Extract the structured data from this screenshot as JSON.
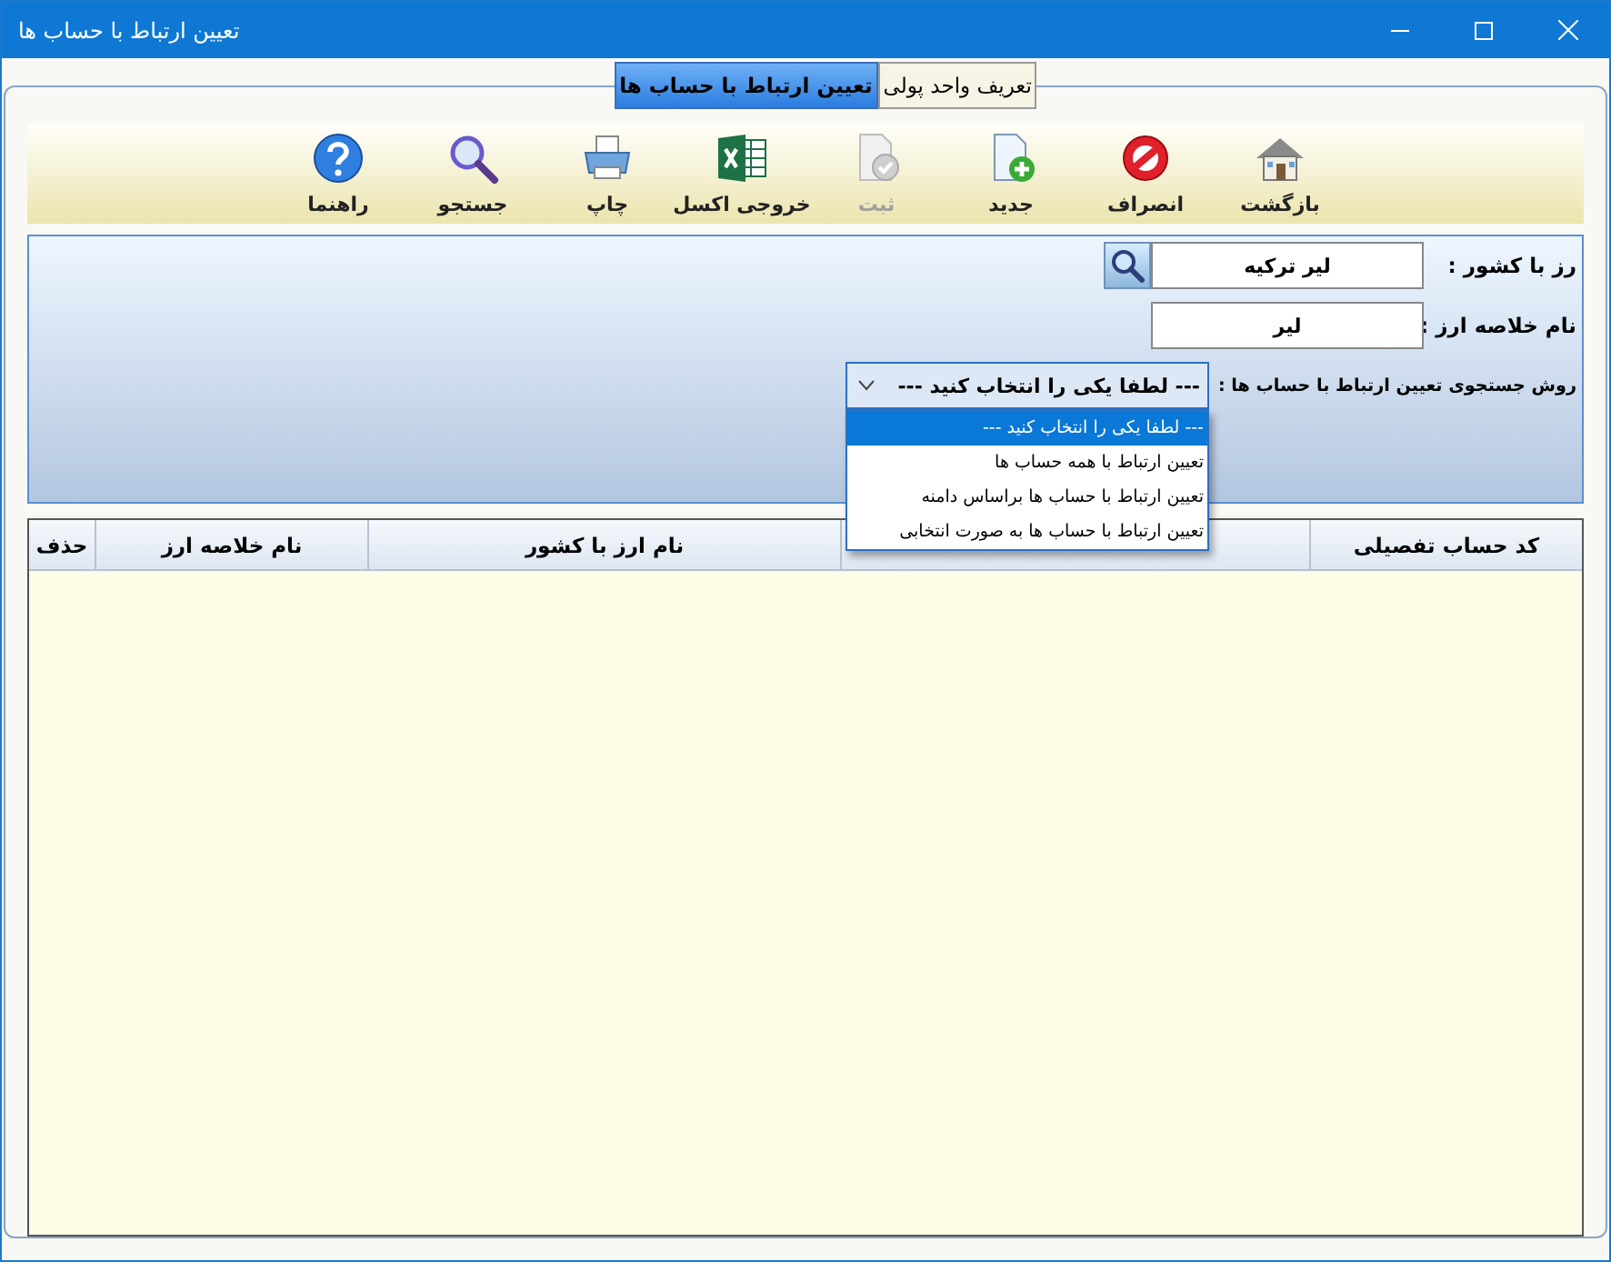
{
  "window": {
    "title": "تعیین ارتباط با حساب ها"
  },
  "tabs": [
    {
      "label": "تعریف واحد پولی",
      "selected": false
    },
    {
      "label": "تعیین ارتباط با حساب ها",
      "selected": true
    }
  ],
  "toolbar": [
    {
      "kind": "home",
      "label": "بازگشت",
      "disabled": false
    },
    {
      "kind": "cancel",
      "label": "انصراف",
      "disabled": false
    },
    {
      "kind": "new",
      "label": "جدید",
      "disabled": false
    },
    {
      "kind": "save",
      "label": "ثبت",
      "disabled": true
    },
    {
      "kind": "excel",
      "label": "خروجی اکسل",
      "disabled": false
    },
    {
      "kind": "print",
      "label": "چاپ",
      "disabled": false
    },
    {
      "kind": "search",
      "label": "جستجو",
      "disabled": false
    },
    {
      "kind": "help",
      "label": "راهنما",
      "disabled": false
    }
  ],
  "form": {
    "currency": {
      "label": "رز با کشور :",
      "value": "لیر ترکیه"
    },
    "abbreviation": {
      "label": "نام خلاصه ارز :",
      "value": "لیر"
    },
    "method": {
      "label": "روش جستجوی تعیین ارتباط با حساب ها :",
      "value": "--- لطفا یکی را انتخاب کنید ---",
      "expanded": true,
      "options": [
        {
          "label": "--- لطفا یکی را انتخاب کنید ---",
          "selected": true
        },
        {
          "label": "تعیین ارتباط با همه حساب ها",
          "selected": false
        },
        {
          "label": "تعیین ارتباط با حساب ها براساس دامنه",
          "selected": false
        },
        {
          "label": "تعیین ارتباط با حساب ها به صورت انتخابی",
          "selected": false
        }
      ]
    }
  },
  "grid": {
    "columns": [
      {
        "kind": "text",
        "label": "کد حساب تفصیلی"
      },
      {
        "kind": "covered"
      },
      {
        "kind": "text",
        "label": "نام ارز با کشور"
      },
      {
        "kind": "text",
        "label": "نام خلاصه ارز"
      },
      {
        "kind": "text",
        "label": "حذف"
      }
    ]
  }
}
